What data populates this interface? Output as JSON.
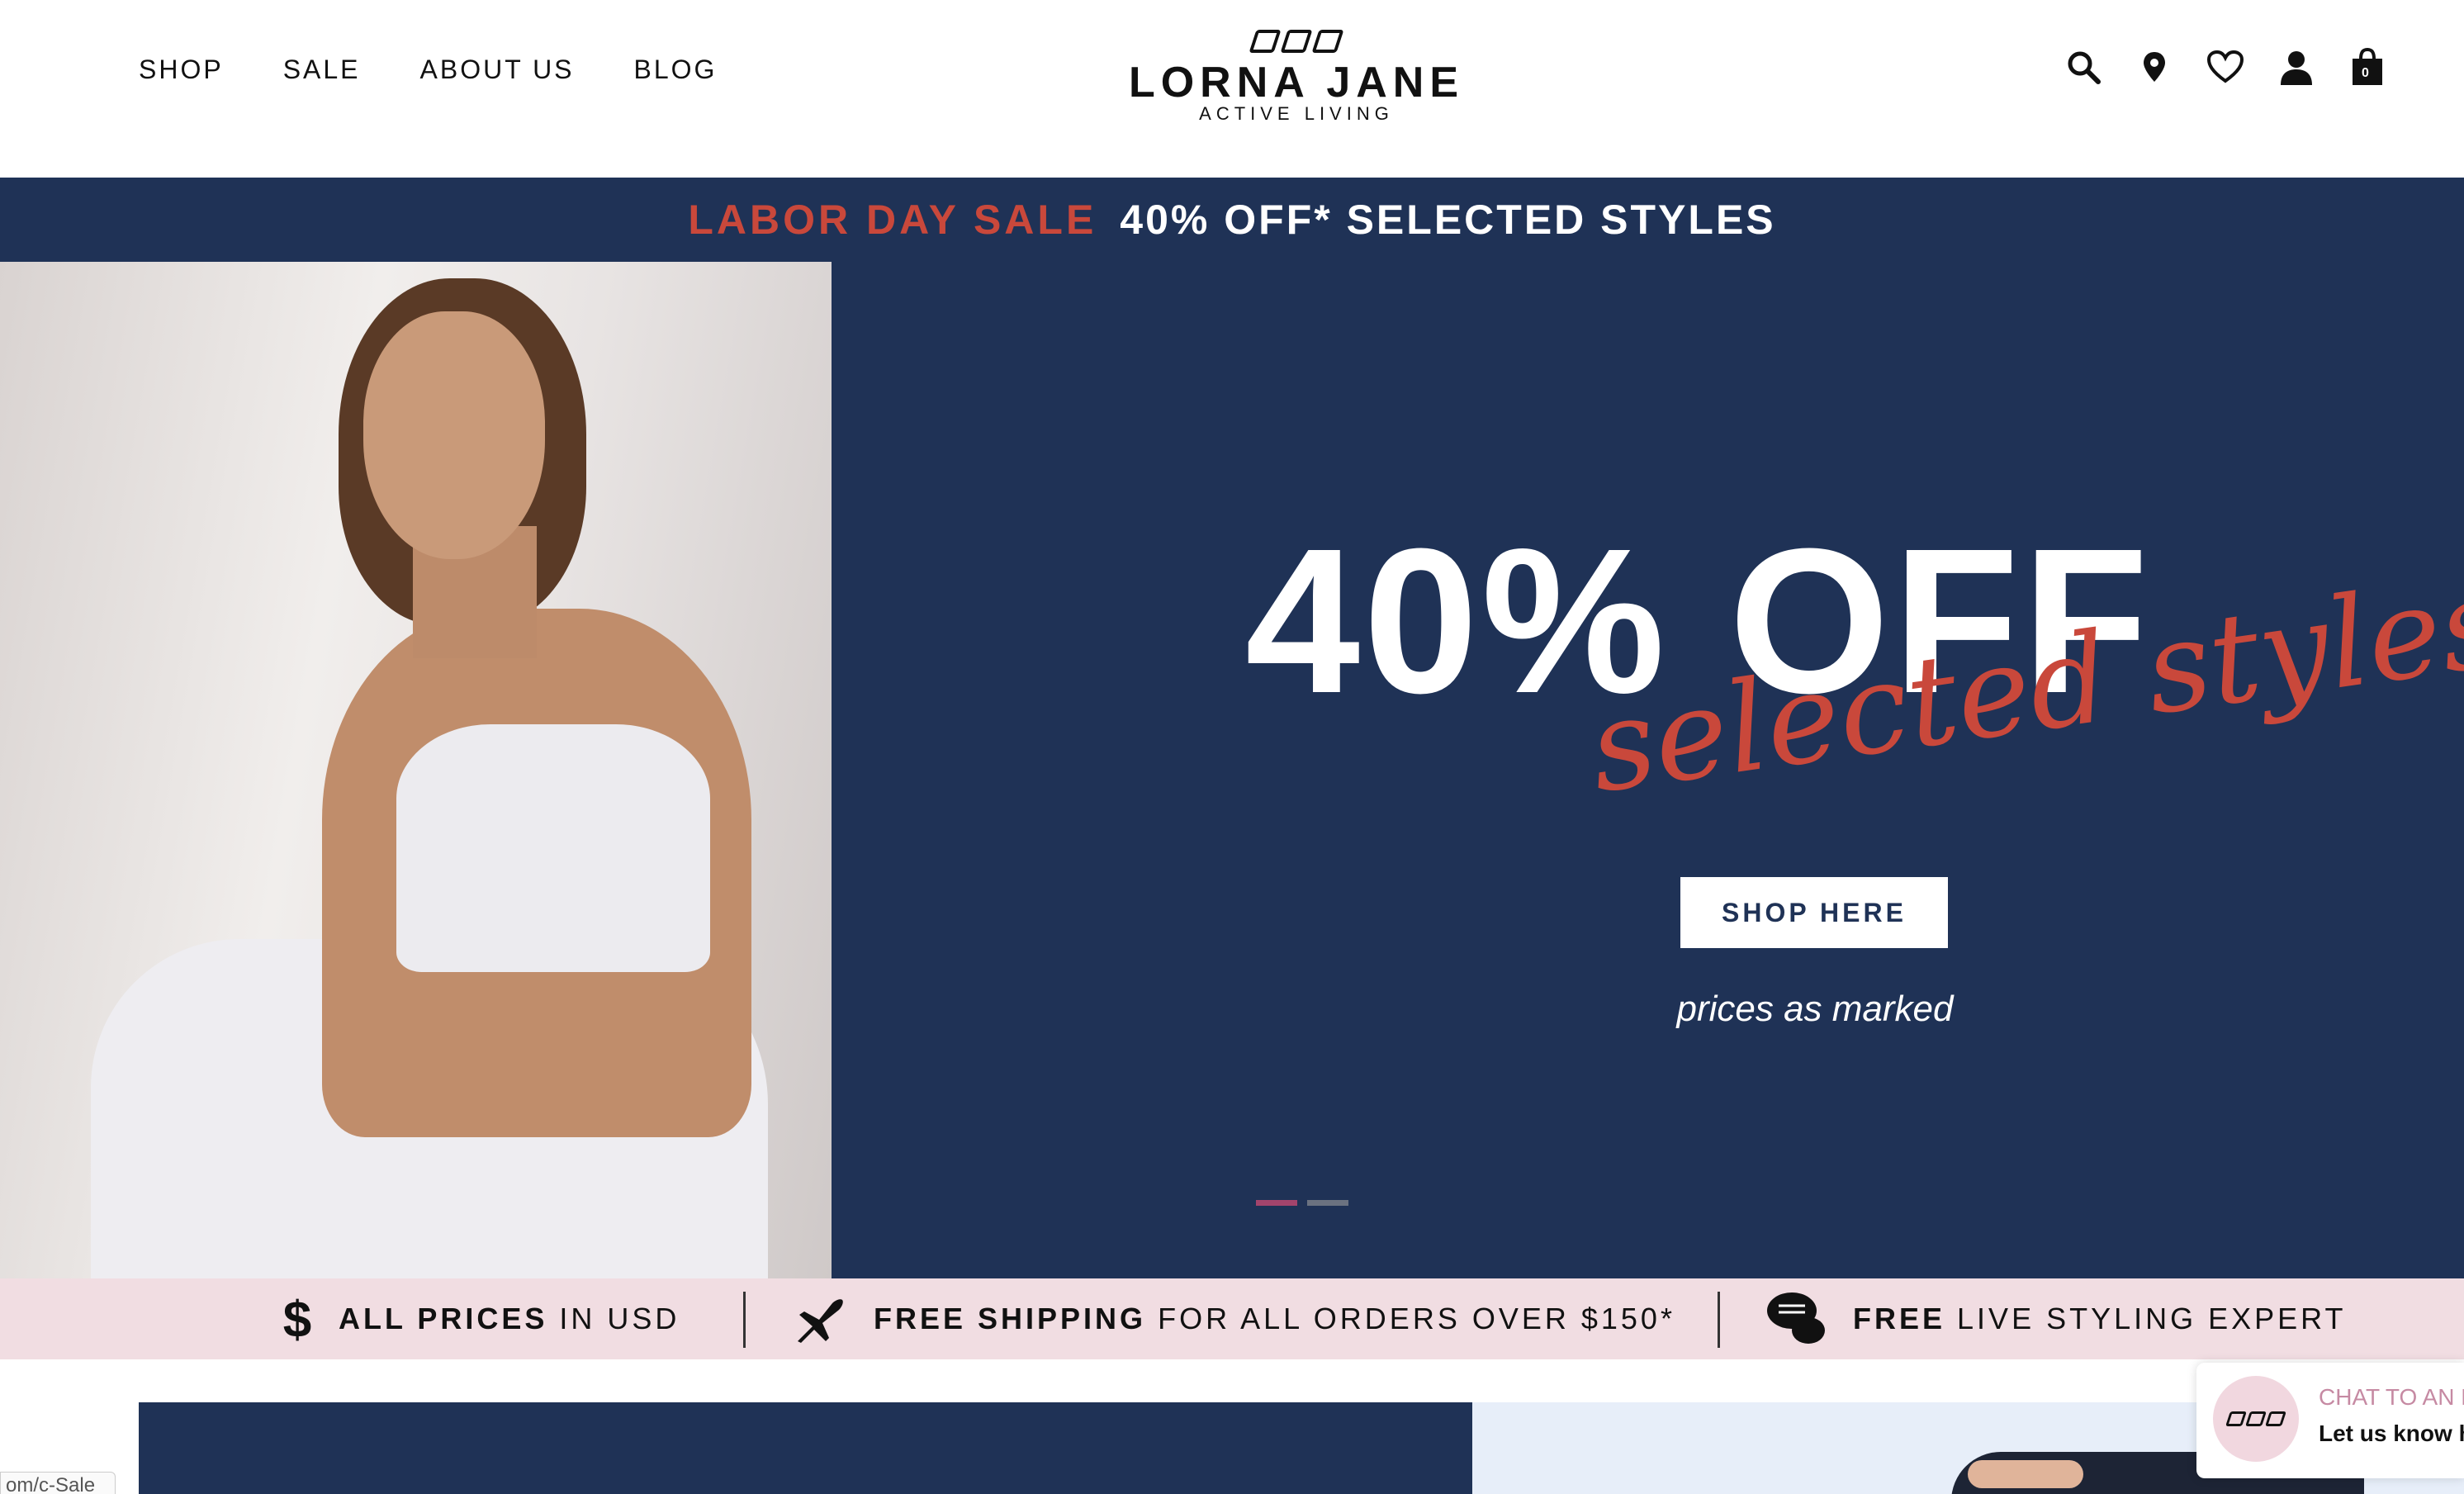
{
  "header": {
    "nav": [
      "SHOP",
      "SALE",
      "ABOUT US",
      "BLOG"
    ],
    "logo": {
      "name": "LORNA JANE",
      "tagline": "ACTIVE LIVING"
    },
    "icons": [
      "search-icon",
      "location-pin-icon",
      "heart-icon",
      "user-icon",
      "shopping-bag-icon"
    ],
    "bag_count": "0"
  },
  "promo": {
    "highlight": "LABOR DAY SALE",
    "text": "40% OFF* SELECTED STYLES"
  },
  "hero": {
    "headline": "40% OFF",
    "script": "selected styles*",
    "button": "SHOP HERE",
    "note": "prices as marked",
    "slides": 2,
    "active_slide": 1
  },
  "benefits": [
    {
      "icon": "dollar-icon",
      "bold": "ALL PRICES",
      "rest": "IN USD"
    },
    {
      "icon": "airplane-icon",
      "bold": "FREE SHIPPING",
      "rest": "FOR ALL ORDERS OVER $150*"
    },
    {
      "icon": "chat-bubbles-icon",
      "bold": "FREE",
      "rest": "LIVE STYLING EXPERT"
    }
  ],
  "status_url": "om/c-Sale",
  "chat": {
    "title": "CHAT TO AN EX",
    "message": "Let us know h"
  },
  "colors": {
    "navy": "#1f3256",
    "sale_red": "#c9483b",
    "benefits_bg": "#f1dde2",
    "chat_title": "#c68aa3",
    "active_dot": "#a3446c"
  }
}
